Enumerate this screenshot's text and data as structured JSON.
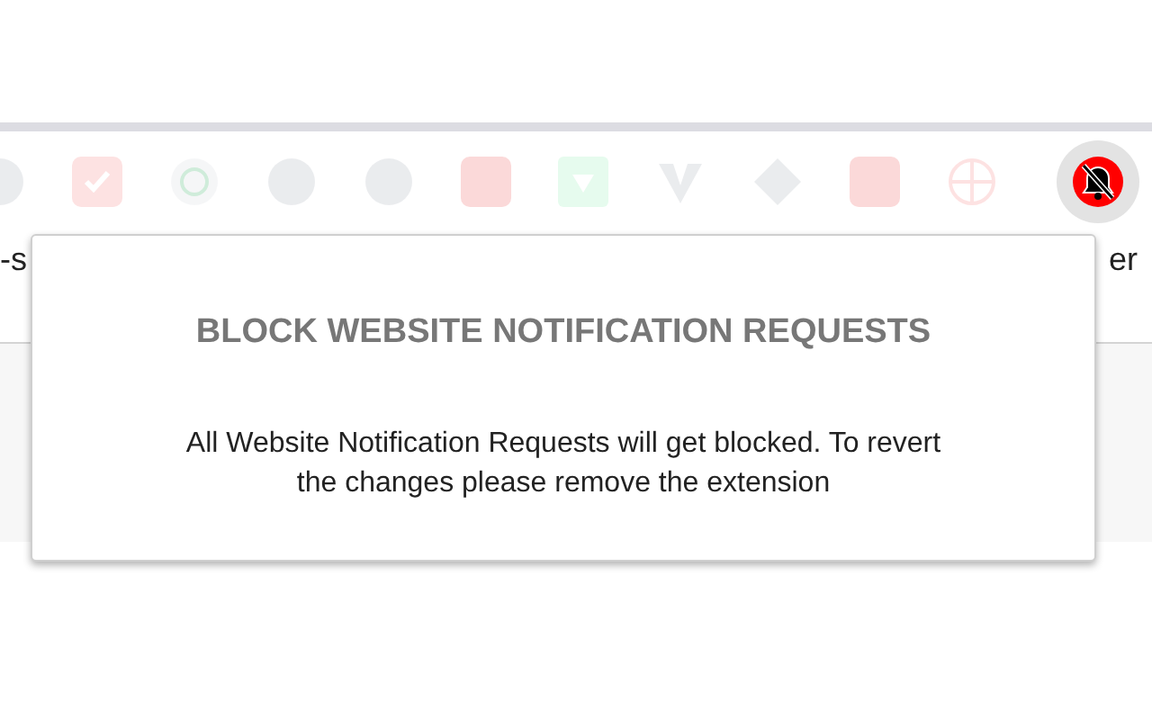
{
  "page": {
    "left_text": "-s",
    "right_text": "er"
  },
  "popup": {
    "title": "BLOCK WEBSITE NOTIFICATION REQUESTS",
    "message": "All Website Notification Requests will get blocked. To revert the changes please remove the extension"
  }
}
